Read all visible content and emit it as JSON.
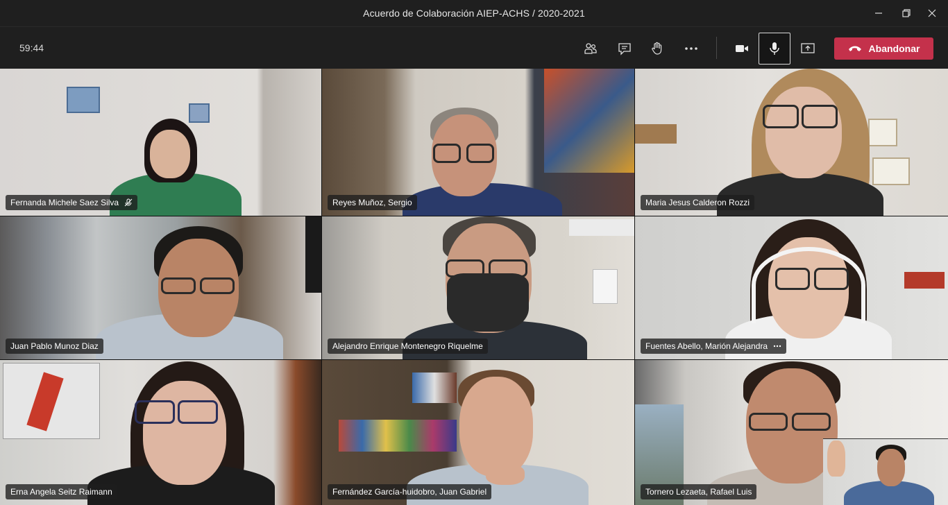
{
  "window": {
    "title": "Acuerdo de Colaboración AIEP-ACHS / 2020-2021",
    "icons": [
      "minimize-icon",
      "maximize-icon",
      "close-icon"
    ]
  },
  "toolbar": {
    "timer": "59:44",
    "leave_label": "Abandonar",
    "leave_color": "#c4314b",
    "icons": [
      "participants-icon",
      "chat-icon",
      "raise-hand-icon",
      "more-options-icon",
      "camera-icon",
      "microphone-icon",
      "share-screen-icon",
      "hang-up-icon"
    ]
  },
  "participants": [
    {
      "name": "Fernanda Michele Saez Silva",
      "muted": true
    },
    {
      "name": "Reyes Muñoz, Sergio"
    },
    {
      "name": "Maria Jesus Calderon Rozzi"
    },
    {
      "name": "Juan Pablo Munoz Diaz"
    },
    {
      "name": "Alejandro Enrique Montenegro Riquelme"
    },
    {
      "name": "Fuentes Abello, Marión Alejandra",
      "menu": true
    },
    {
      "name": "Erna Angela Seitz Raimann"
    },
    {
      "name": "Fernández García-huidobro, Juan Gabriel"
    },
    {
      "name": "Tornero Lezaeta, Rafael Luis"
    }
  ]
}
